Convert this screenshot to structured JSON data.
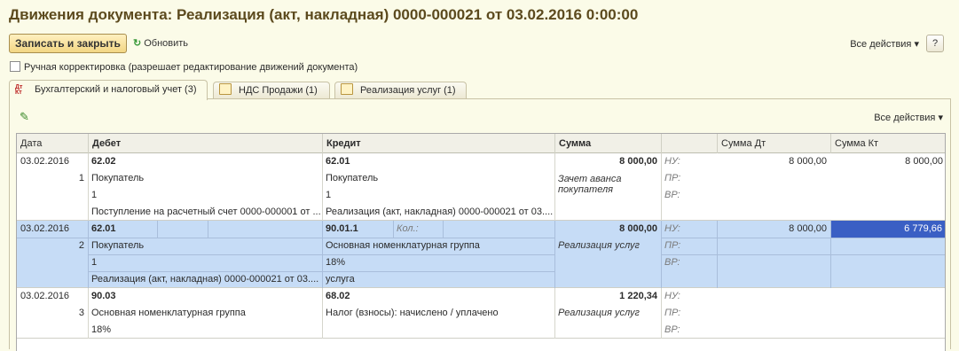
{
  "window": {
    "title": "Движения документа: Реализация (акт, накладная) 0000-000021 от 03.02.2016 0:00:00"
  },
  "toolbar": {
    "save_close_label": "Записать и закрыть",
    "refresh_label": "Обновить",
    "all_actions_label": "Все действия",
    "help_label": "?"
  },
  "manual_edit": {
    "checked": false,
    "label": "Ручная корректировка (разрешает редактирование движений документа)"
  },
  "tabs": [
    {
      "label": "Бухгалтерский и налоговый учет (3)",
      "icon": "dt-kt-icon",
      "active": true
    },
    {
      "label": "НДС Продажи (1)",
      "icon": "register-icon",
      "active": false
    },
    {
      "label": "Реализация услуг (1)",
      "icon": "register-icon",
      "active": false
    }
  ],
  "panel": {
    "all_actions_label": "Все действия",
    "edit_icon": "pencil-icon"
  },
  "table": {
    "columns": [
      "Дата",
      "Дебет",
      "Кредит",
      "Сумма",
      "",
      "Сумма Дт",
      "Сумма Кт"
    ],
    "rows": [
      {
        "date": "03.02.2016",
        "num": "1",
        "debit_account": "62.02",
        "debit_sub1": "Покупатель",
        "debit_sub2": "1",
        "debit_sub3": "Поступление на расчетный счет 0000-000001 от ...",
        "credit_account": "62.01",
        "credit_sub1": "Покупатель",
        "credit_sub2": "1",
        "credit_sub3": "Реализация (акт, накладная) 0000-000021 от 03....",
        "amount": "8 000,00",
        "content": "Зачет аванса покупателя",
        "nu_label": "НУ:",
        "pr_label": "ПР:",
        "vr_label": "ВР:",
        "nu_dt": "8 000,00",
        "nu_kt": "8 000,00"
      },
      {
        "date": "03.02.2016",
        "num": "2",
        "debit_account": "62.01",
        "debit_sub1": "Покупатель",
        "debit_sub2": "1",
        "debit_sub3": "Реализация (акт, накладная) 0000-000021 от 03....",
        "credit_account": "90.01.1",
        "credit_qty_label": "Кол.:",
        "credit_sub1": "Основная номенклатурная группа",
        "credit_sub2": "18%",
        "credit_sub3": "услуга",
        "amount": "8 000,00",
        "content": "Реализация услуг",
        "nu_label": "НУ:",
        "pr_label": "ПР:",
        "vr_label": "ВР:",
        "nu_dt": "8 000,00",
        "nu_kt": "6 779,66"
      },
      {
        "date": "03.02.2016",
        "num": "3",
        "debit_account": "90.03",
        "debit_sub1": "Основная номенклатурная группа",
        "debit_sub2": "18%",
        "credit_account": "68.02",
        "credit_sub1": "Налог (взносы): начислено / уплачено",
        "amount": "1 220,34",
        "content": "Реализация услуг",
        "nu_label": "НУ:",
        "pr_label": "ПР:",
        "vr_label": "ВР:"
      }
    ]
  }
}
